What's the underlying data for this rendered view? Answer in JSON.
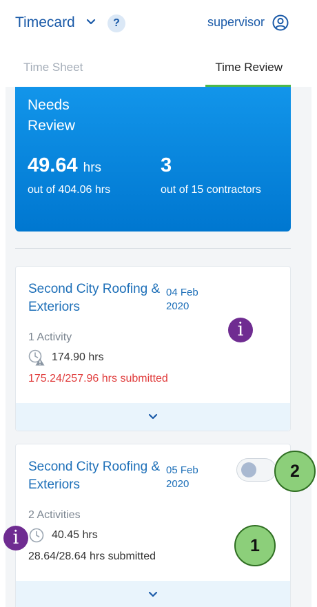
{
  "header": {
    "title": "Timecard",
    "help_label": "?",
    "user": "supervisor"
  },
  "tabs": [
    {
      "label": "Time Sheet",
      "active": false
    },
    {
      "label": "Time Review",
      "active": true
    }
  ],
  "summary": {
    "title": "Needs Review",
    "hours_value": "49.64",
    "hours_unit": "hrs",
    "hours_sub": "out of 404.06 hrs",
    "count_value": "3",
    "count_sub": "out of 15 contractors"
  },
  "cards": [
    {
      "name": "Second City Roofing & Exteriors",
      "date": "04 Feb 2020",
      "activity": "1 Activity",
      "hours": "174.90 hrs",
      "submitted": "175.24/257.96 hrs submitted",
      "status": "warning"
    },
    {
      "name": "Second City Roofing & Exteriors",
      "date": "05 Feb 2020",
      "activity": "2 Activities",
      "hours": "40.45 hrs",
      "submitted": "28.64/28.64 hrs submitted",
      "status": "ok",
      "toggle_on": false
    }
  ],
  "annotations": {
    "info_glyph": "i",
    "marker_1": "1",
    "marker_2": "2"
  },
  "colors": {
    "brand_blue": "#1a5aa8",
    "summary_gradient_top": "#1295ea",
    "summary_gradient_bottom": "#0077d0",
    "active_tab_underline": "#4cb84a",
    "warning_text": "#e03b3b",
    "expand_bar": "#e9f4fc",
    "info_badge": "#6f2c91",
    "marker_badge": "#8ccf7a"
  },
  "icons": [
    "chevron-down-icon",
    "help-icon",
    "user-icon",
    "clock-warning-icon",
    "clock-icon",
    "info-icon"
  ]
}
